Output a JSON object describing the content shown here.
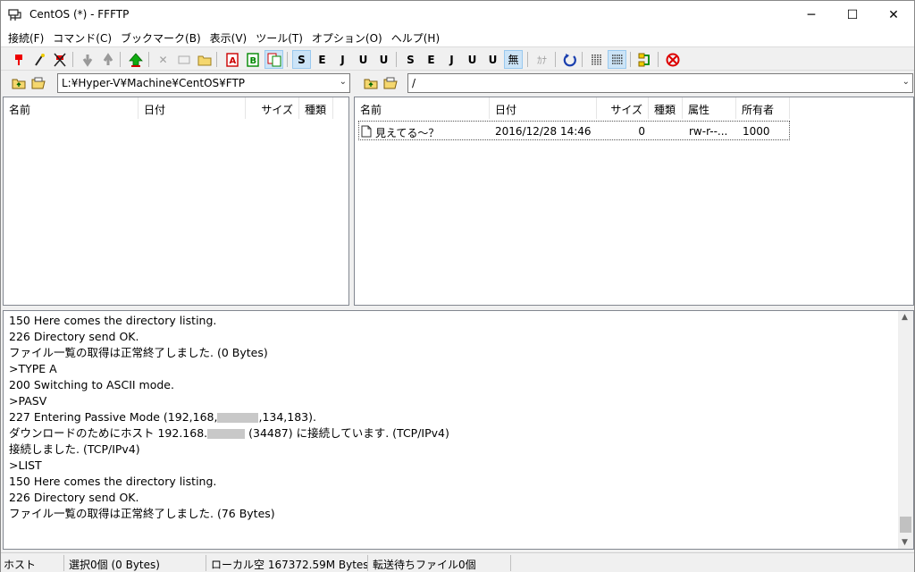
{
  "window": {
    "title": "CentOS (*) - FFFTP",
    "controls": {
      "minimize": "─",
      "maximize": "☐",
      "close": "✕"
    }
  },
  "menu": [
    "接続(F)",
    "コマンド(C)",
    "ブックマーク(B)",
    "表示(V)",
    "ツール(T)",
    "オプション(O)",
    "ヘルプ(H)"
  ],
  "toolbar": {
    "kanji_sjis": "S",
    "kanji_euc": "E",
    "kanji_jis": "J",
    "kanji_utf8n": "U",
    "kanji_utf8bom": "U",
    "kanji_remote_sjis": "S",
    "kanji_remote_euc": "E",
    "kanji_remote_jis": "J",
    "kanji_remote_utf8n": "U",
    "kanji_remote_utf8bom": "U",
    "no_conv": "無",
    "kana": "ｶﾅ"
  },
  "local": {
    "path": "L:¥Hyper-V¥Machine¥CentOS¥FTP",
    "columns": [
      "名前",
      "日付",
      "サイズ",
      "種類"
    ]
  },
  "remote": {
    "path": "/",
    "columns": [
      "名前",
      "日付",
      "サイズ",
      "種類",
      "属性",
      "所有者"
    ],
    "files": [
      {
        "name": "見えてる～？",
        "date": "2016/12/28 14:46",
        "size": "0",
        "type": "",
        "attr": "rw-r--...",
        "owner": "1000"
      }
    ]
  },
  "log": {
    "l1": "150 Here comes the directory listing.",
    "l2": "226 Directory send OK.",
    "l3": "ファイル一覧の取得は正常終了しました. (0 Bytes)",
    "l4": ">TYPE A",
    "l5": "200 Switching to ASCII mode.",
    "l6": ">PASV",
    "l7a": "227 Entering Passive Mode (192,168,",
    "l7b": ",134,183).",
    "l8a": "ダウンロードのためにホスト 192.168.",
    "l8b": " (34487) に接続しています. (TCP/IPv4)",
    "l9": "接続しました. (TCP/IPv4)",
    "l10": ">LIST",
    "l11": "150 Here comes the directory listing.",
    "l12": "226 Directory send OK.",
    "l13": "ファイル一覧の取得は正常終了しました. (76 Bytes)"
  },
  "status": {
    "host": "ホスト",
    "selection": "選択0個 (0 Bytes)",
    "local_free": "ローカル空 167372.59M Bytes",
    "queue": "転送待ちファイル0個"
  }
}
